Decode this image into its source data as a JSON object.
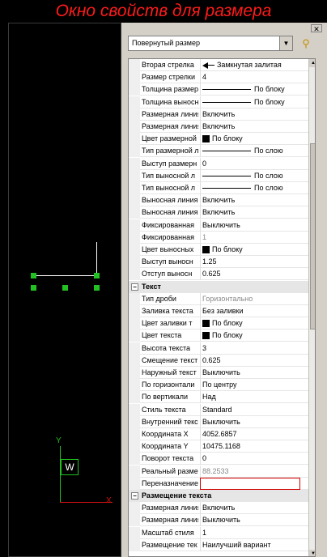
{
  "title": "Окно свойств для размера",
  "palette": {
    "object_type": "Повернутый размер",
    "rows": [
      {
        "label": "Вторая стрелка",
        "value": "Замкнутая залитая",
        "kind": "arrow"
      },
      {
        "label": "Размер стрелки",
        "value": "4"
      },
      {
        "label": "Толщина размер",
        "value": "По блоку",
        "kind": "line"
      },
      {
        "label": "Толщина выносн",
        "value": "По блоку",
        "kind": "line"
      },
      {
        "label": "Размерная линия",
        "value": "Включить"
      },
      {
        "label": "Размерная линия",
        "value": "Включить"
      },
      {
        "label": "Цвет размерной",
        "value": "По блоку",
        "kind": "swatch"
      },
      {
        "label": "Тип размерной л",
        "value": "По слою",
        "kind": "line"
      },
      {
        "label": "Выступ размерн",
        "value": "0"
      },
      {
        "label": "Тип выносной л",
        "value": "По слою",
        "kind": "line"
      },
      {
        "label": "Тип выносной л",
        "value": "По слою",
        "kind": "line"
      },
      {
        "label": "Выносная линия",
        "value": "Включить"
      },
      {
        "label": "Выносная линия",
        "value": "Включить"
      },
      {
        "label": "Фиксированная",
        "value": "Выключить"
      },
      {
        "label": "Фиксированная",
        "value": "1",
        "grey": true
      },
      {
        "label": "Цвет выносных",
        "value": "По блоку",
        "kind": "swatch"
      },
      {
        "label": "Выступ выносн",
        "value": "1.25"
      },
      {
        "label": "Отступ выносн",
        "value": "0.625"
      },
      {
        "section": "Текст"
      },
      {
        "label": "Тип дроби",
        "value": "Горизонтально",
        "grey": true
      },
      {
        "label": "Заливка текста",
        "value": "Без заливки"
      },
      {
        "label": "Цвет заливки т",
        "value": "По блоку",
        "kind": "swatch"
      },
      {
        "label": "Цвет текста",
        "value": "По блоку",
        "kind": "swatch"
      },
      {
        "label": "Высота текста",
        "value": "3"
      },
      {
        "label": "Смещение текст",
        "value": "0.625"
      },
      {
        "label": "Наружный текст",
        "value": "Выключить"
      },
      {
        "label": "По горизонтали",
        "value": "По центру"
      },
      {
        "label": "По вертикали",
        "value": "Над"
      },
      {
        "label": "Стиль текста",
        "value": "Standard"
      },
      {
        "label": "Внутренний текс",
        "value": "Выключить"
      },
      {
        "label": "Координата X",
        "value": "4052.6857"
      },
      {
        "label": "Координата Y",
        "value": "10475.1168"
      },
      {
        "label": "Поворот текста",
        "value": "0"
      },
      {
        "label": "Реальный разме",
        "value": "88.2533",
        "grey": true
      },
      {
        "label": "Переназначение",
        "value": "",
        "kind": "edit"
      },
      {
        "section": "Размещение текста"
      },
      {
        "label": "Размерная линия",
        "value": "Включить"
      },
      {
        "label": "Размерная линия",
        "value": "Выключить"
      },
      {
        "label": "Масштаб стиля",
        "value": "1"
      },
      {
        "label": "Размещение тек",
        "value": "Наилучший вариант"
      }
    ]
  },
  "viewport": {
    "ucs_y_label": "Y",
    "ucs_w_label": "W",
    "ucs_x_label": "X"
  },
  "colors": {
    "title": "#ff1a1a",
    "grip": "#22c022",
    "edit_border": "#d00000"
  }
}
